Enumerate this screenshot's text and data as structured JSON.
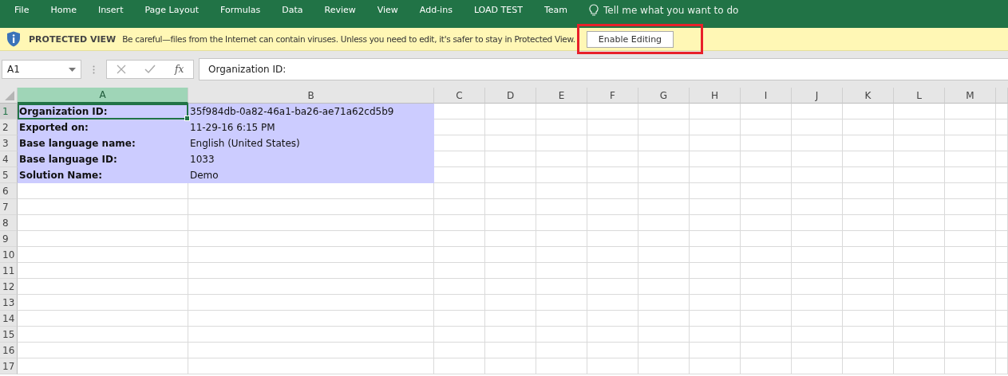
{
  "ribbon": {
    "tabs": [
      "File",
      "Home",
      "Insert",
      "Page Layout",
      "Formulas",
      "Data",
      "Review",
      "View",
      "Add-ins",
      "LOAD TEST",
      "Team"
    ],
    "tell_me": "Tell me what you want to do"
  },
  "protected_view": {
    "title": "PROTECTED VIEW",
    "message": "Be careful—files from the Internet can contain viruses. Unless you need to edit, it's safer to stay in Protected View.",
    "button": "Enable Editing",
    "highlighted": true
  },
  "formula_bar": {
    "name_box": "A1",
    "fx": "fx",
    "formula": "Organization ID:"
  },
  "columns": [
    {
      "label": "A",
      "selected": true
    },
    {
      "label": "B",
      "selected": false
    },
    {
      "label": "C",
      "selected": false
    },
    {
      "label": "D",
      "selected": false
    },
    {
      "label": "E",
      "selected": false
    },
    {
      "label": "F",
      "selected": false
    },
    {
      "label": "G",
      "selected": false
    },
    {
      "label": "H",
      "selected": false
    },
    {
      "label": "I",
      "selected": false
    },
    {
      "label": "J",
      "selected": false
    },
    {
      "label": "K",
      "selected": false
    },
    {
      "label": "L",
      "selected": false
    },
    {
      "label": "M",
      "selected": false
    }
  ],
  "rows": [
    {
      "number": "1",
      "selected": true,
      "highlighted": true,
      "cells": [
        {
          "text": "Organization ID:",
          "active": true
        },
        {
          "text": "35f984db-0a82-46a1-ba26-ae71a62cd5b9",
          "active": false
        }
      ]
    },
    {
      "number": "2",
      "selected": false,
      "highlighted": true,
      "cells": [
        {
          "text": "Exported on:",
          "active": false
        },
        {
          "text": "11-29-16 6:15 PM",
          "active": false
        }
      ]
    },
    {
      "number": "3",
      "selected": false,
      "highlighted": true,
      "cells": [
        {
          "text": "Base language name:",
          "active": false
        },
        {
          "text": "English (United States)",
          "active": false
        }
      ]
    },
    {
      "number": "4",
      "selected": false,
      "highlighted": true,
      "cells": [
        {
          "text": "Base language ID:",
          "active": false
        },
        {
          "text": "1033",
          "active": false
        }
      ]
    },
    {
      "number": "5",
      "selected": false,
      "highlighted": true,
      "cells": [
        {
          "text": "Solution Name:",
          "active": false
        },
        {
          "text": "Demo",
          "active": false
        }
      ]
    },
    {
      "number": "6",
      "selected": false,
      "highlighted": false,
      "cells": []
    },
    {
      "number": "7",
      "selected": false,
      "highlighted": false,
      "cells": []
    },
    {
      "number": "8",
      "selected": false,
      "highlighted": false,
      "cells": []
    },
    {
      "number": "9",
      "selected": false,
      "highlighted": false,
      "cells": []
    },
    {
      "number": "10",
      "selected": false,
      "highlighted": false,
      "cells": []
    },
    {
      "number": "11",
      "selected": false,
      "highlighted": false,
      "cells": []
    },
    {
      "number": "12",
      "selected": false,
      "highlighted": false,
      "cells": []
    },
    {
      "number": "13",
      "selected": false,
      "highlighted": false,
      "cells": []
    },
    {
      "number": "14",
      "selected": false,
      "highlighted": false,
      "cells": []
    },
    {
      "number": "15",
      "selected": false,
      "highlighted": false,
      "cells": []
    },
    {
      "number": "16",
      "selected": false,
      "highlighted": false,
      "cells": []
    },
    {
      "number": "17",
      "selected": false,
      "highlighted": false,
      "cells": []
    }
  ]
}
